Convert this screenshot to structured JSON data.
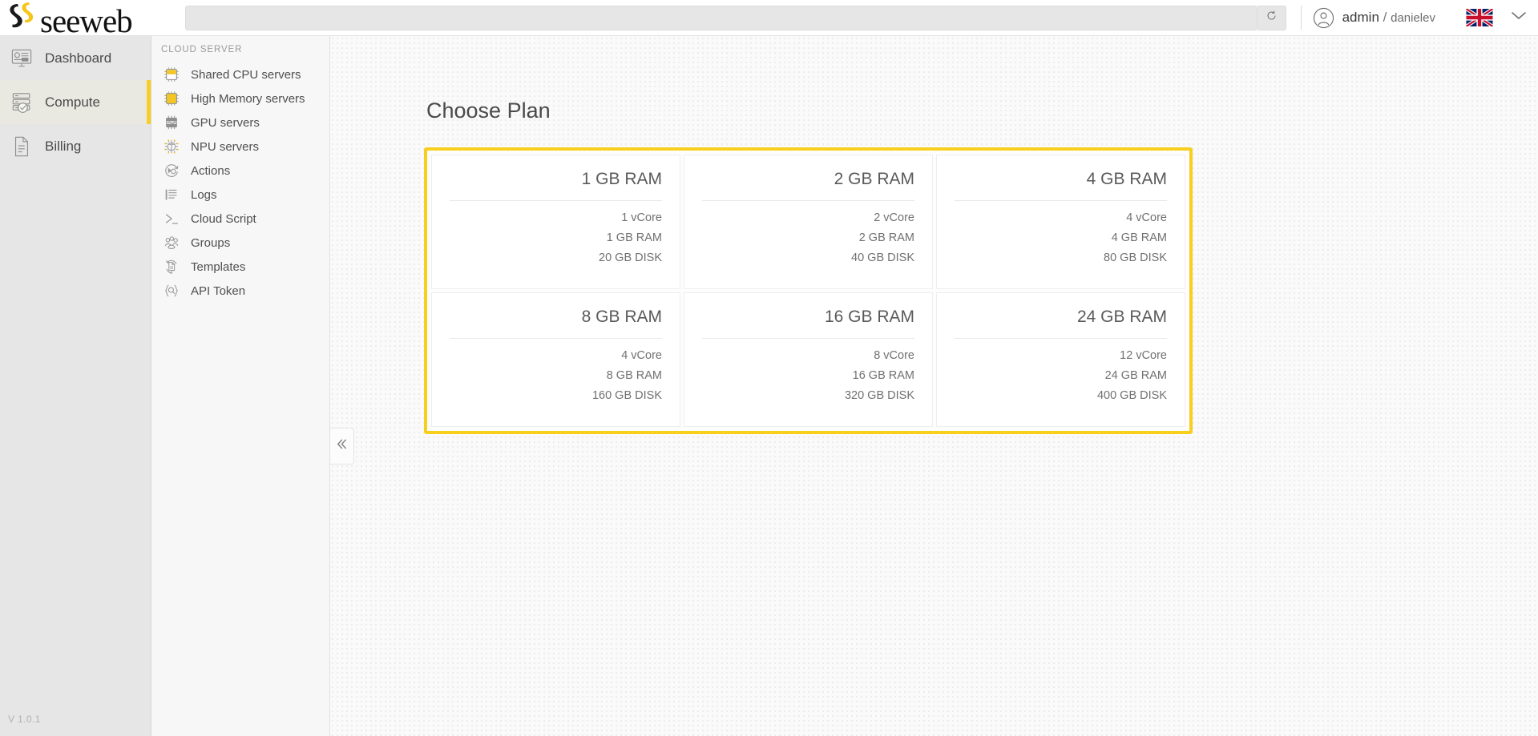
{
  "header": {
    "logo_text": "seeweb",
    "logo_icon": "seeweb-logo-mark",
    "search_value": "",
    "search_placeholder": "",
    "refresh_icon": "refresh-icon",
    "avatar_icon": "user-avatar-icon",
    "user_primary": "admin",
    "user_separator": "/",
    "user_secondary": "danielev",
    "flag_icon": "uk-flag-icon",
    "chevron_icon": "chevron-down-icon"
  },
  "sidebar": {
    "items": [
      {
        "label": "Dashboard",
        "icon": "dashboard-icon",
        "active": false
      },
      {
        "label": "Compute",
        "icon": "server-stack-icon",
        "active": true
      },
      {
        "label": "Billing",
        "icon": "document-icon",
        "active": false
      }
    ],
    "version": "V 1.0.1",
    "accent_color": "#f7cd28"
  },
  "subpanel": {
    "title": "CLOUD SERVER",
    "collapse_icon": "chevron-double-left-icon",
    "items": [
      {
        "label": "Shared CPU servers",
        "icon": "chip-half-icon"
      },
      {
        "label": "High Memory servers",
        "icon": "chip-full-icon"
      },
      {
        "label": "GPU servers",
        "icon": "gpu-chip-icon"
      },
      {
        "label": "NPU servers",
        "icon": "npu-chip-icon"
      },
      {
        "label": "Actions",
        "icon": "actions-gear-icon"
      },
      {
        "label": "Logs",
        "icon": "logs-list-icon"
      },
      {
        "label": "Cloud Script",
        "icon": "terminal-prompt-icon"
      },
      {
        "label": "Groups",
        "icon": "groups-people-icon"
      },
      {
        "label": "Templates",
        "icon": "templates-refresh-icon"
      },
      {
        "label": "API Token",
        "icon": "api-token-braces-icon"
      }
    ]
  },
  "main": {
    "title": "Choose Plan",
    "highlight_color": "#f8ce1f",
    "plans": [
      {
        "name": "1 GB RAM",
        "cpu": "1 vCore",
        "ram": "1 GB RAM",
        "disk": "20 GB DISK"
      },
      {
        "name": "2 GB RAM",
        "cpu": "2 vCore",
        "ram": "2 GB RAM",
        "disk": "40 GB DISK"
      },
      {
        "name": "4 GB RAM",
        "cpu": "4 vCore",
        "ram": "4 GB RAM",
        "disk": "80 GB DISK"
      },
      {
        "name": "8 GB RAM",
        "cpu": "4 vCore",
        "ram": "8 GB RAM",
        "disk": "160 GB DISK"
      },
      {
        "name": "16 GB RAM",
        "cpu": "8 vCore",
        "ram": "16 GB RAM",
        "disk": "320 GB DISK"
      },
      {
        "name": "24 GB RAM",
        "cpu": "12 vCore",
        "ram": "24 GB RAM",
        "disk": "400 GB DISK"
      }
    ]
  }
}
